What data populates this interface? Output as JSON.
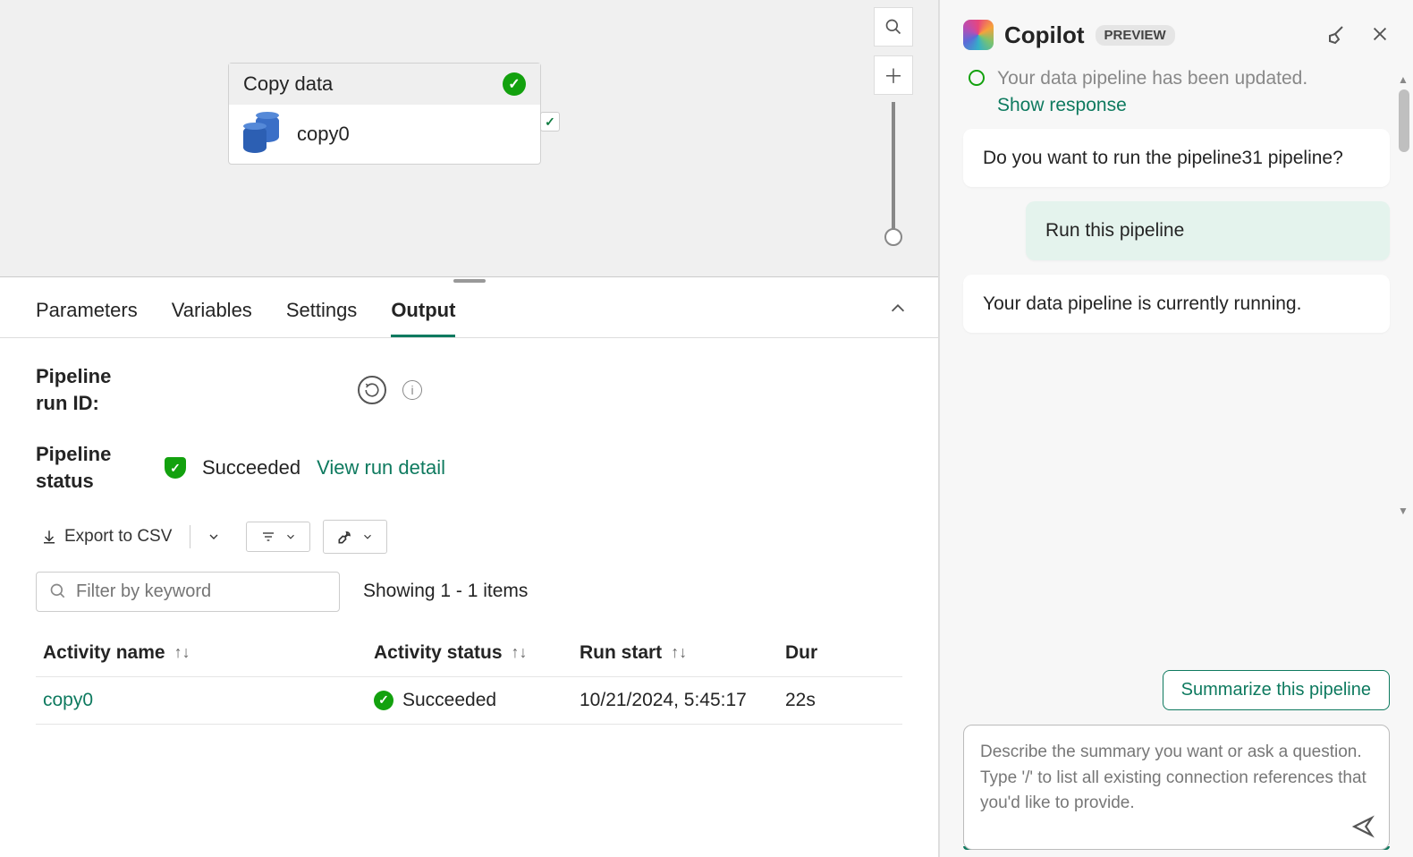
{
  "canvas": {
    "activity_title": "Copy data",
    "activity_name": "copy0"
  },
  "tabs": {
    "parameters": "Parameters",
    "variables": "Variables",
    "settings": "Settings",
    "output": "Output"
  },
  "output": {
    "run_id_label": "Pipeline run ID:",
    "status_label": "Pipeline status",
    "status_value": "Succeeded",
    "view_run_detail": "View run detail",
    "export_csv": "Export to CSV",
    "filter_placeholder": "Filter by keyword",
    "showing_text": "Showing 1 - 1 items",
    "columns": {
      "activity_name": "Activity name",
      "activity_status": "Activity status",
      "run_start": "Run start",
      "duration": "Dur"
    },
    "rows": [
      {
        "activity_name": "copy0",
        "activity_status": "Succeeded",
        "run_start": "10/21/2024, 5:45:17",
        "duration": "22s"
      }
    ]
  },
  "copilot": {
    "title": "Copilot",
    "badge": "PREVIEW",
    "truncated_status": "Your data pipeline has been updated.",
    "show_response": "Show response",
    "messages": [
      {
        "role": "assistant",
        "text": "Do you want to run the pipeline31 pipeline?"
      },
      {
        "role": "user",
        "text": "Run this pipeline"
      },
      {
        "role": "assistant",
        "text": "Your data pipeline is currently running."
      }
    ],
    "suggestion": "Summarize this pipeline",
    "input_placeholder": "Describe the summary you want or ask a question.\nType '/' to list all existing connection references that you'd like to provide."
  }
}
